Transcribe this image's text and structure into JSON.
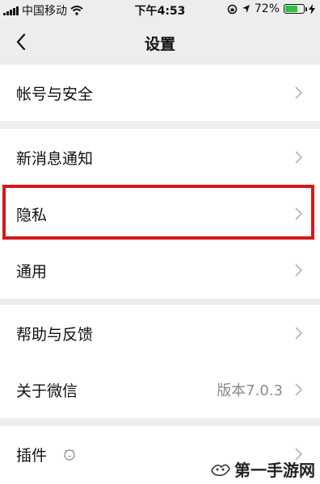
{
  "status_bar": {
    "carrier": "中国移动",
    "time": "下午4:53",
    "battery_percent": "72%",
    "battery_level": 0.72
  },
  "nav": {
    "title": "设置",
    "back_icon": "chevron-left-icon"
  },
  "groups": [
    {
      "items": [
        {
          "label": "帐号与安全"
        }
      ]
    },
    {
      "items": [
        {
          "label": "新消息通知"
        },
        {
          "label": "隐私"
        },
        {
          "label": "通用"
        }
      ]
    },
    {
      "items": [
        {
          "label": "帮助与反馈"
        },
        {
          "label": "关于微信",
          "value": "版本7.0.3"
        }
      ]
    },
    {
      "items": [
        {
          "label": "插件"
        }
      ]
    }
  ],
  "highlight_color": "#d01a1a",
  "watermark": {
    "text": "第一手游网"
  }
}
